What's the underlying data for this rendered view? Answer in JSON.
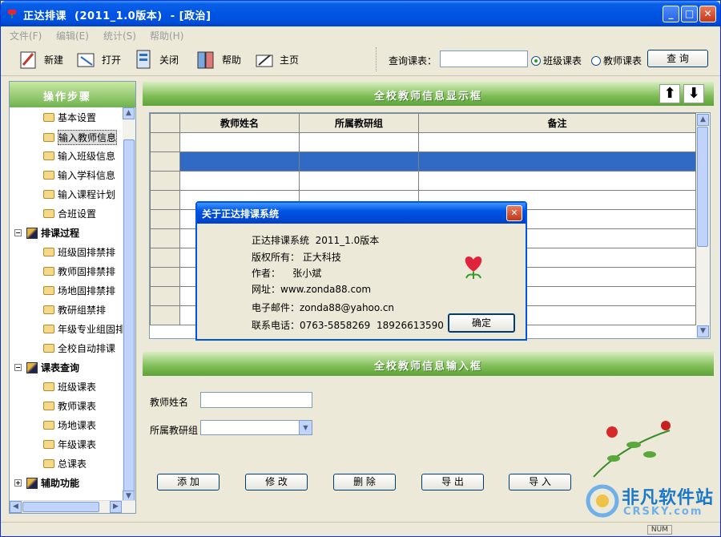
{
  "window": {
    "title": "正达排课  (2011_1.0版本)  - [政治]"
  },
  "menu": [
    "文件(F)",
    "编辑(E)",
    "统计(S)",
    "帮助(H)"
  ],
  "toolbar": {
    "buttons": [
      {
        "label": "新建",
        "icon": "new-icon"
      },
      {
        "label": "打开",
        "icon": "open-icon"
      },
      {
        "label": "关闭",
        "icon": "close-doc-icon"
      },
      {
        "label": "帮助",
        "icon": "help-icon"
      },
      {
        "label": "主页",
        "icon": "home-icon"
      }
    ],
    "query_label": "查询课表：",
    "query_value": "",
    "radio_class": "班级课表",
    "radio_teacher": "教师课表",
    "query_button": "查 询"
  },
  "sidebar": {
    "header": "操作步骤",
    "step_items": [
      "基本设置",
      "输入教师信息",
      "输入班级信息",
      "输入学科信息",
      "输入课程计划",
      "合班设置"
    ],
    "group1": "排课过程",
    "group1_items": [
      "班级固排禁排",
      "教师固排禁排",
      "场地固排禁排",
      "教研组禁排",
      "年级专业组固排",
      "全校自动排课"
    ],
    "group2": "课表查询",
    "group2_items": [
      "班级课表",
      "教师课表",
      "场地课表",
      "年级课表",
      "总课表"
    ],
    "group3": "辅助功能"
  },
  "display_panel": {
    "title": "全校教师信息显示框",
    "columns": [
      "教师姓名",
      "所属教研组",
      "备注"
    ],
    "rows": 11,
    "selected_row": 2
  },
  "input_panel": {
    "title": "全校教师信息输入框",
    "name_label": "教师姓名",
    "name_value": "",
    "group_label": "所属教研组",
    "group_value": "",
    "buttons": [
      "添 加",
      "修 改",
      "删 除",
      "导 出",
      "导 入"
    ]
  },
  "dialog": {
    "title": "关于正达排课系统",
    "lines": [
      "正达排课系统  2011_1.0版本",
      "版权所有： 正大科技",
      "作者：    张小斌",
      "网址：www.zonda88.com",
      "电子邮件：zonda88@yahoo.cn",
      "联系电话：0763-5858269  18926613590"
    ],
    "ok": "确定"
  },
  "statusbar": {
    "num": "NUM"
  },
  "watermark": {
    "line1": "非凡软件站",
    "line2": "CRSKY.com"
  }
}
